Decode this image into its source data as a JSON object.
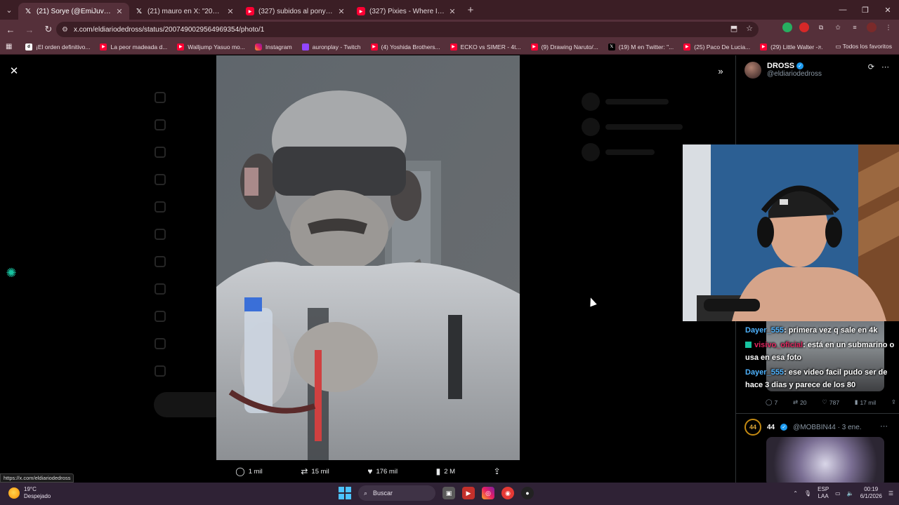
{
  "browser": {
    "tabs": [
      {
        "title": "(21) Sorye (@EmiJuvenal) / X",
        "icon": "x-icon",
        "active": true
      },
      {
        "title": "(21) mauro en X: \"2025: grok e",
        "icon": "x-icon",
        "active": false
      },
      {
        "title": "(327) subidos al pony - YouTub",
        "icon": "youtube-icon",
        "active": false
      },
      {
        "title": "(327) Pixies - Where Is My Mind",
        "icon": "youtube-icon",
        "active": false
      }
    ],
    "url": "x.com/eldiariodedross/status/2007490029564969354/photo/1",
    "bookmarks": [
      {
        "label": "¡El orden definitivo...",
        "icon": "d"
      },
      {
        "label": "La peor madeada d...",
        "icon": "yt"
      },
      {
        "label": "Walljump Yasuo mo...",
        "icon": "yt"
      },
      {
        "label": "Instagram",
        "icon": "ig"
      },
      {
        "label": "auronplay - Twitch",
        "icon": "tw"
      },
      {
        "label": "(4) Yoshida Brothers...",
        "icon": "yt"
      },
      {
        "label": "ECKO vs SIMER - 4t...",
        "icon": "yt"
      },
      {
        "label": "(9) Drawing Naruto/...",
        "icon": "yt"
      },
      {
        "label": "(19) M en Twitter: \"...",
        "icon": "x"
      },
      {
        "label": "(25) Paco De Lucia...",
        "icon": "yt"
      },
      {
        "label": "(29) Little Walter -...",
        "icon": "yt"
      }
    ],
    "bookmarks_all": "Todos los favoritos",
    "status_url": "https://x.com/eldiariodedross"
  },
  "post": {
    "actions": {
      "replies": "1 mil",
      "reposts": "15 mil",
      "likes": "176 mil",
      "views": "2 M"
    }
  },
  "side": {
    "author_name": "DROSS",
    "author_handle": "@eldiariodedross",
    "stats": {
      "replies": "7",
      "reposts": "20",
      "likes": "787",
      "views": "17 mil"
    },
    "next": {
      "name": "44",
      "handle": "@MOBBIN44 · 3 ene.",
      "avatar": "44"
    }
  },
  "chat": [
    {
      "user": "Dayer_555",
      "color": "#4fb3ff",
      "text": ": primera vez q sale en 4k",
      "badge": false
    },
    {
      "user": "visivo_oficial",
      "color": "#e0245e",
      "text": ": está en un submarino o usa en esa foto",
      "badge": true
    },
    {
      "user": "Dayer_555",
      "color": "#4fb3ff",
      "text": ": ese video facil pudo ser de hace 3 dias y parece de los 80",
      "badge": false
    }
  ],
  "taskbar": {
    "temp": "19°C",
    "weather": "Despejado",
    "search": "Buscar",
    "lang": "ESP",
    "lang2": "LAA",
    "time": "00:19",
    "date": "6/1/2026"
  }
}
